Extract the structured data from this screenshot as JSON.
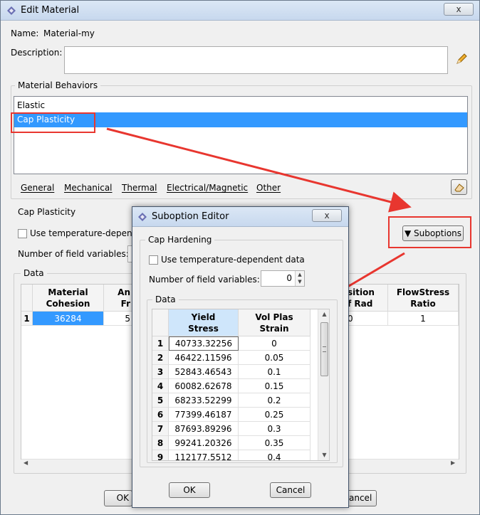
{
  "main_window": {
    "title": "Edit Material",
    "close_label": "x",
    "name_label": "Name:",
    "name_value": "Material-my",
    "description_label": "Description:",
    "description_value": "",
    "behaviors_group": "Material Behaviors",
    "behaviors": [
      "Elastic",
      "Cap Plasticity"
    ],
    "selected_behavior": "Cap Plasticity",
    "menus": [
      "General",
      "Mechanical",
      "Thermal",
      "Electrical/Magnetic",
      "Other"
    ],
    "section_title": "Cap Plasticity",
    "use_temp_label": "Use temperature-depende",
    "field_vars_label": "Number of field variables:",
    "suboptions_label": "Suboptions",
    "data_group": "Data",
    "table": {
      "headers": [
        {
          "line1": "Material",
          "line2": "Cohesion"
        },
        {
          "line1": "An",
          "line2": "Fr"
        },
        {
          "line1": "sition",
          "line2": "f Rad"
        },
        {
          "line1": "FlowStress",
          "line2": "Ratio"
        }
      ],
      "row_number": "1",
      "values": [
        "36284",
        "5",
        "0",
        "1"
      ]
    },
    "ok_label": "OK",
    "cancel_label": "ancel"
  },
  "suboption_editor": {
    "title": "Suboption Editor",
    "close_label": "x",
    "group_title": "Cap Hardening",
    "use_temp_label": "Use temperature-dependent data",
    "field_vars_label": "Number of field variables:",
    "field_vars_value": "0",
    "data_group": "Data",
    "headers": [
      {
        "line1": "Yield",
        "line2": "Stress"
      },
      {
        "line1": "Vol Plas",
        "line2": "Strain"
      }
    ],
    "rows": [
      {
        "n": "1",
        "stress": "40733.32256",
        "strain": "0"
      },
      {
        "n": "2",
        "stress": "46422.11596",
        "strain": "0.05"
      },
      {
        "n": "3",
        "stress": "52843.46543",
        "strain": "0.1"
      },
      {
        "n": "4",
        "stress": "60082.62678",
        "strain": "0.15"
      },
      {
        "n": "5",
        "stress": "68233.52299",
        "strain": "0.2"
      },
      {
        "n": "6",
        "stress": "77399.46187",
        "strain": "0.25"
      },
      {
        "n": "7",
        "stress": "87693.89296",
        "strain": "0.3"
      },
      {
        "n": "8",
        "stress": "99241.20326",
        "strain": "0.35"
      },
      {
        "n": "9",
        "stress": "112177.5512",
        "strain": "0.4"
      }
    ],
    "ok_label": "OK",
    "cancel_label": "Cancel"
  },
  "colors": {
    "selection": "#3399ff",
    "annotation_red": "#e8362f",
    "header_selected": "#cfe6fb"
  }
}
